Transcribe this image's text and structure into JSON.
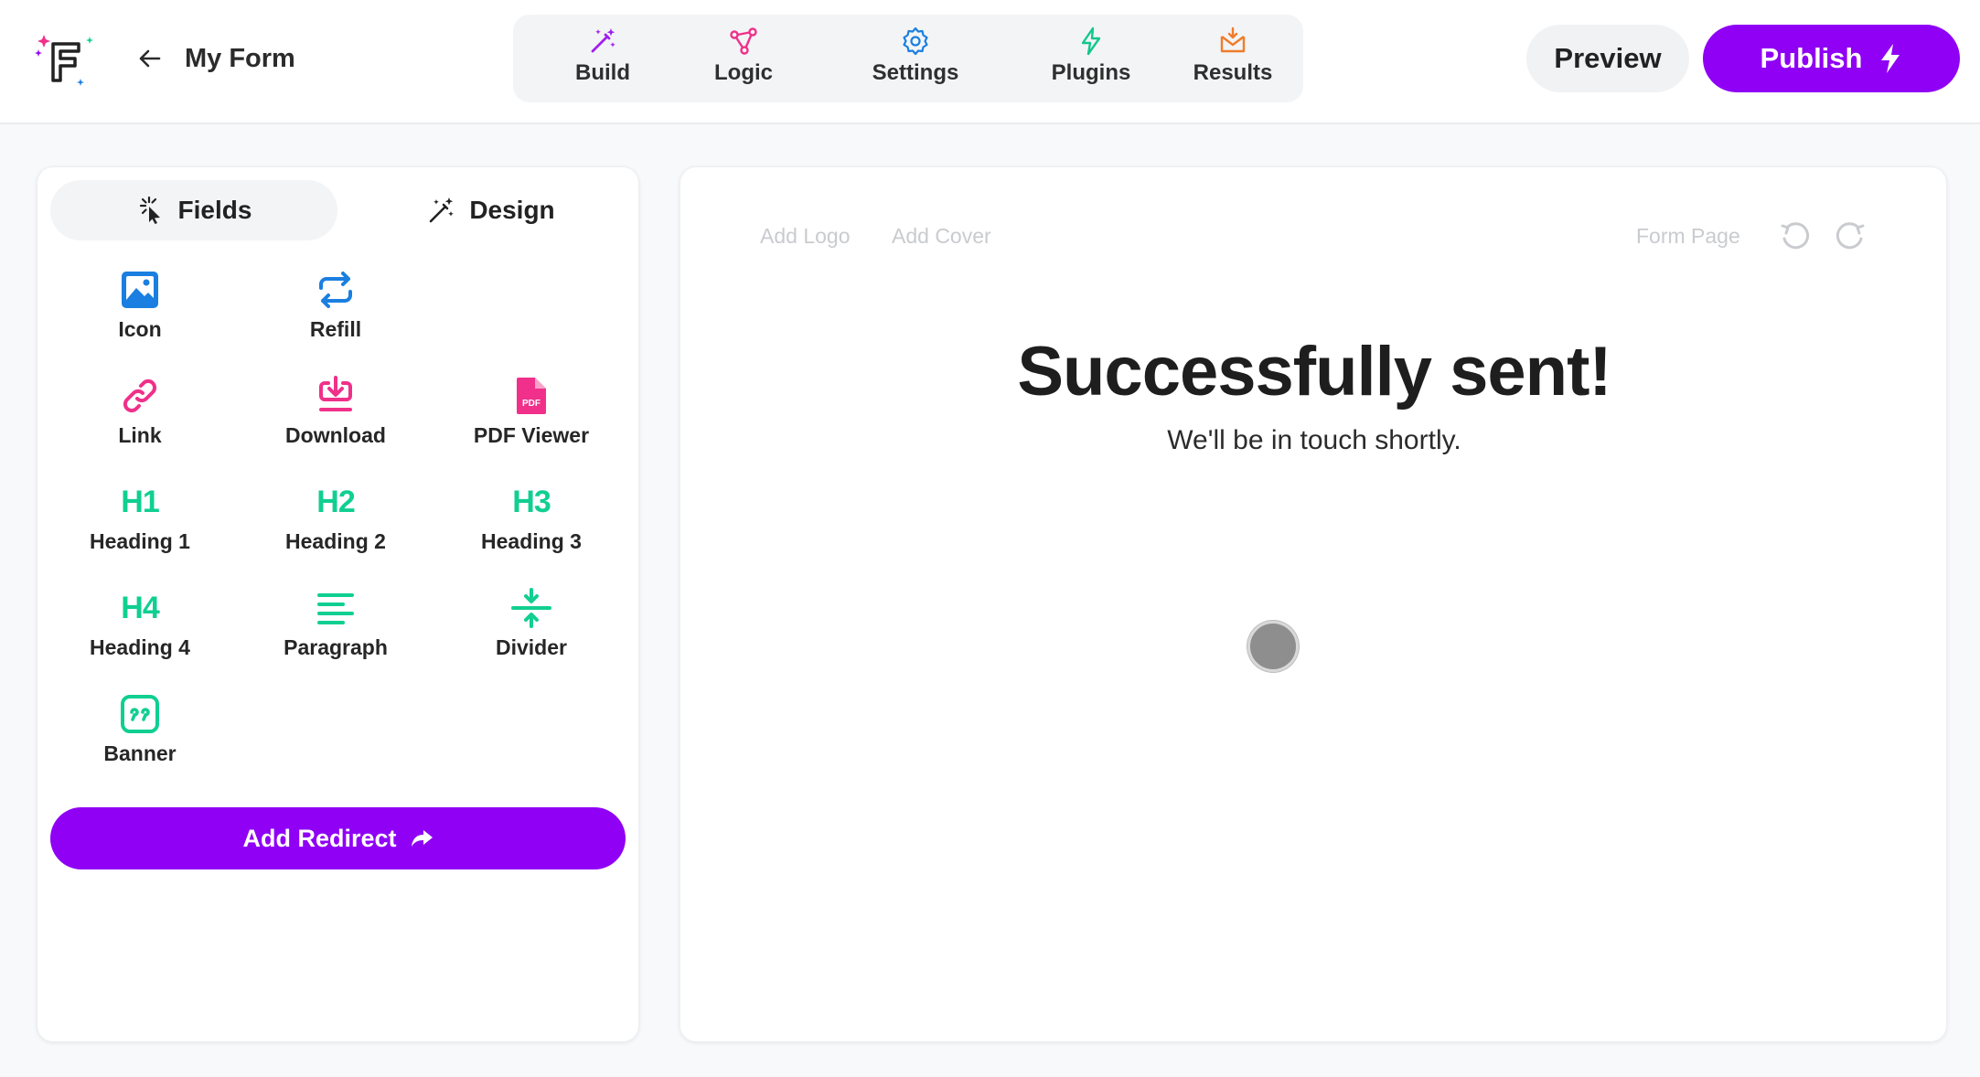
{
  "header": {
    "form_name": "My Form",
    "nav": [
      {
        "label": "Build",
        "icon": "magic-wand-icon",
        "color": "#a020f0"
      },
      {
        "label": "Logic",
        "icon": "logic-nodes-icon",
        "color": "#f0308a"
      },
      {
        "label": "Settings",
        "icon": "gear-icon",
        "color": "#1a7fe0"
      },
      {
        "label": "Plugins",
        "icon": "lightning-icon",
        "color": "#14c78a"
      },
      {
        "label": "Results",
        "icon": "inbox-download-icon",
        "color": "#f07c2a"
      }
    ],
    "preview_label": "Preview",
    "publish_label": "Publish"
  },
  "panel": {
    "tabs": {
      "fields": "Fields",
      "design": "Design"
    },
    "fields": [
      {
        "label": "Icon",
        "icon": "image-icon"
      },
      {
        "label": "Refill",
        "icon": "refill-icon"
      },
      {
        "label": "Link",
        "icon": "link-icon"
      },
      {
        "label": "Download",
        "icon": "download-icon"
      },
      {
        "label": "PDF Viewer",
        "icon": "pdf-icon",
        "badge": "PDF"
      },
      {
        "label": "Heading 1",
        "glyph": "H1"
      },
      {
        "label": "Heading 2",
        "glyph": "H2"
      },
      {
        "label": "Heading 3",
        "glyph": "H3"
      },
      {
        "label": "Heading 4",
        "glyph": "H4"
      },
      {
        "label": "Paragraph",
        "icon": "paragraph-icon"
      },
      {
        "label": "Divider",
        "icon": "divider-icon"
      },
      {
        "label": "Banner",
        "icon": "quote-banner-icon"
      }
    ],
    "redirect_label": "Add Redirect"
  },
  "canvas": {
    "add_logo": "Add Logo",
    "add_cover": "Add Cover",
    "form_page": "Form Page",
    "title": "Successfully sent!",
    "subtitle": "We'll be in touch shortly."
  },
  "colors": {
    "accent": "#8f00f5",
    "blue": "#1a7fe0",
    "pink": "#f0308a",
    "green": "#10cf91"
  }
}
